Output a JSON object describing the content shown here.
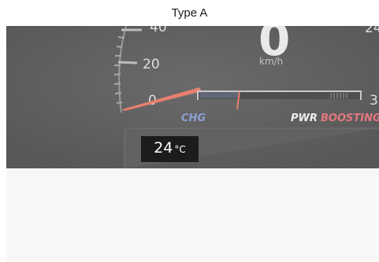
{
  "caption": "Type A",
  "cluster": {
    "speed_value": "0",
    "speed_unit": "km/h",
    "ticks": {
      "t40": "40",
      "t20": "20",
      "t0": "0"
    },
    "right_ticks": {
      "upper": "24",
      "lower": "3"
    },
    "power_gauge": {
      "chg_label": "CHG",
      "pwr_label": "PWR",
      "boost_label": "BOOSTING"
    }
  },
  "climate": {
    "temperature": "24",
    "unit": "°C"
  },
  "colors": {
    "chg": "#8d9fd6",
    "boost": "#e4777f",
    "needle": "#e8806f",
    "cluster_bg": "#5f5f5f"
  }
}
